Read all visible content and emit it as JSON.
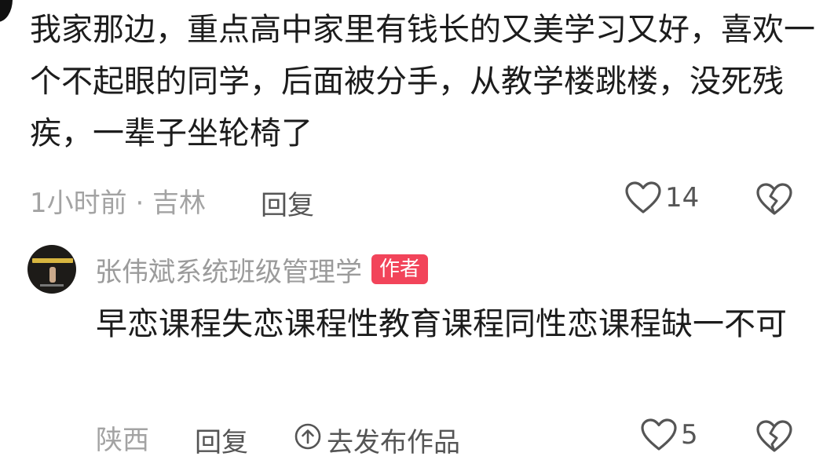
{
  "comment1": {
    "text": "我家那边，重点高中家里有钱长的又美学习又好，喜欢一个不起眼的同学，后面被分手，从教学楼跳楼，没死残疾，一辈子坐轮椅了",
    "time_location": "1小时前 · 吉林",
    "reply_label": "回复",
    "like_count": "14",
    "like_icon": "heart-outline",
    "dislike_icon": "broken-heart"
  },
  "reply": {
    "author_name": "张伟斌系统班级管理学",
    "author_badge": "作者",
    "badge_color": "#f2445a",
    "text": "早恋课程失恋课程性教育课程同性恋课程缺一不可",
    "location": "陕西",
    "reply_label": "回复",
    "share_label": "去发布作品",
    "share_icon": "arrow-up-circle",
    "like_count": "5",
    "like_icon": "heart-outline",
    "dislike_icon": "broken-heart"
  }
}
